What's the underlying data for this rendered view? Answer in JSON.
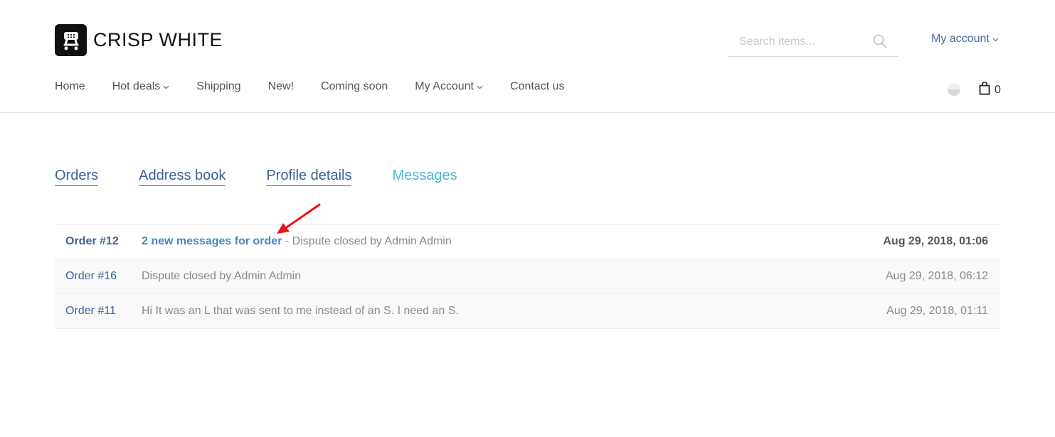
{
  "brand": {
    "name": "CRISP WHITE"
  },
  "search": {
    "placeholder": "Search items..."
  },
  "account_menu": {
    "label": "My account"
  },
  "nav": [
    {
      "label": "Home",
      "dropdown": false
    },
    {
      "label": "Hot deals",
      "dropdown": true
    },
    {
      "label": "Shipping",
      "dropdown": false
    },
    {
      "label": "New!",
      "dropdown": false
    },
    {
      "label": "Coming soon",
      "dropdown": false
    },
    {
      "label": "My Account",
      "dropdown": true
    },
    {
      "label": "Contact us",
      "dropdown": false
    }
  ],
  "cart": {
    "count": "0"
  },
  "tabs": [
    {
      "label": "Orders",
      "active": false
    },
    {
      "label": "Address book",
      "active": false
    },
    {
      "label": "Profile details",
      "active": false
    },
    {
      "label": "Messages",
      "active": true
    }
  ],
  "messages": [
    {
      "order": "Order #12",
      "highlight": "2 new messages for order",
      "separator": " - ",
      "text": "Dispute closed by Admin Admin",
      "date": "Aug 29, 2018, 01:06",
      "unread": true
    },
    {
      "order": "Order #16",
      "text": "Dispute closed by Admin Admin",
      "date": "Aug 29, 2018, 06:12",
      "unread": false
    },
    {
      "order": "Order #11",
      "text": "Hi It was an L that was sent to me instead of an S. I need an S.",
      "date": "Aug 29, 2018, 01:11",
      "unread": false
    }
  ],
  "colors": {
    "link": "#3f5f99",
    "active_tab": "#4fb3d4",
    "highlight": "#4a86c0",
    "annotation_arrow": "#e8141b"
  }
}
